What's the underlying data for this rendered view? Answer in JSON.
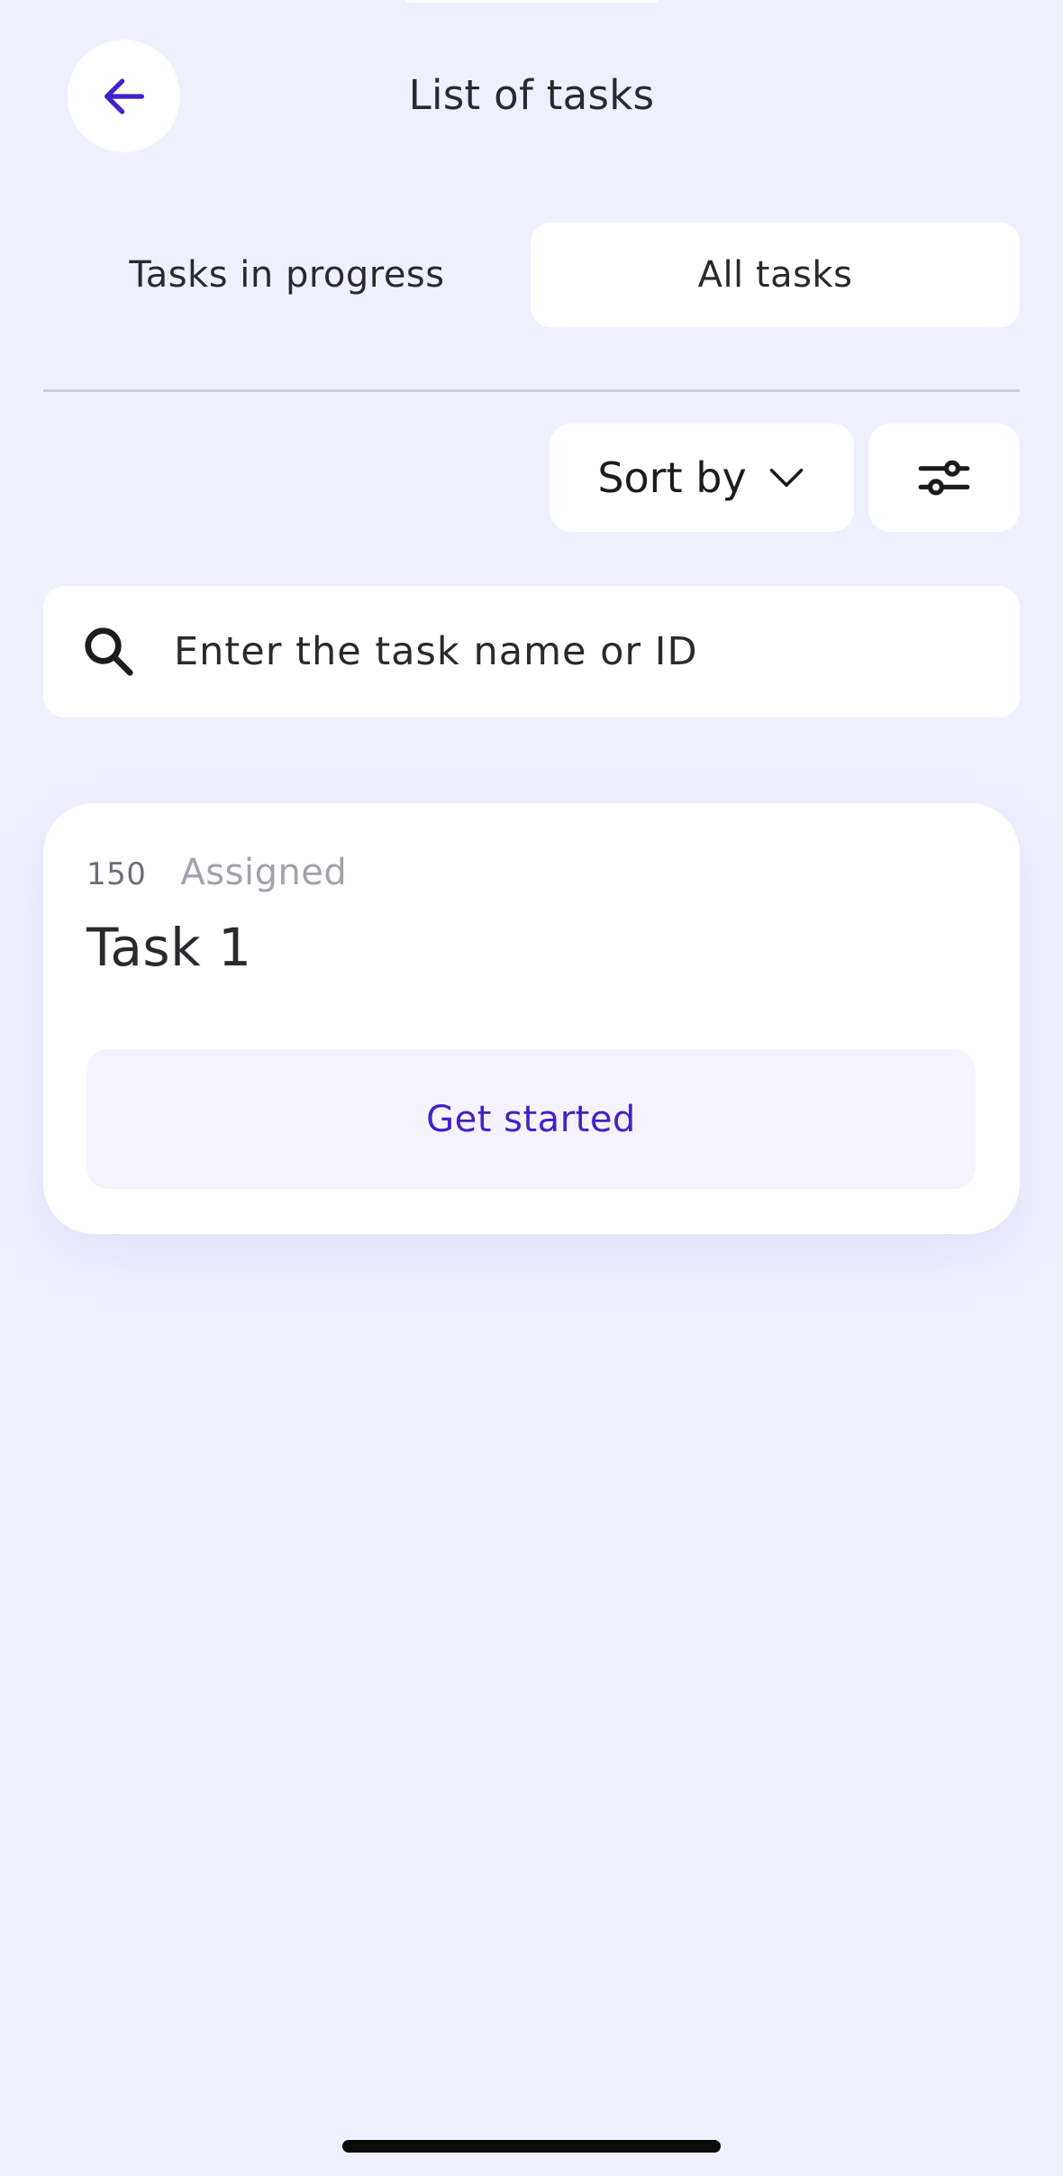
{
  "header": {
    "title": "List of tasks",
    "back_icon": "arrow-left-icon",
    "accent_color": "#4420C8"
  },
  "tabs": [
    {
      "label": "Tasks in progress",
      "selected": false
    },
    {
      "label": "All tasks",
      "selected": true
    }
  ],
  "toolbar": {
    "sort_label": "Sort by",
    "sort_icon": "chevron-down-icon",
    "filter_icon": "sliders-icon"
  },
  "search": {
    "placeholder": "Enter the task name or ID",
    "value": "",
    "icon": "search-icon"
  },
  "tasks": [
    {
      "id": "150",
      "status": "Assigned",
      "name": "Task 1",
      "action_label": "Get started"
    }
  ],
  "colors": {
    "background": "#EFF0FE",
    "surface": "#FFFFFF",
    "accent": "#4420C8",
    "action_background": "#F5F3FE"
  }
}
